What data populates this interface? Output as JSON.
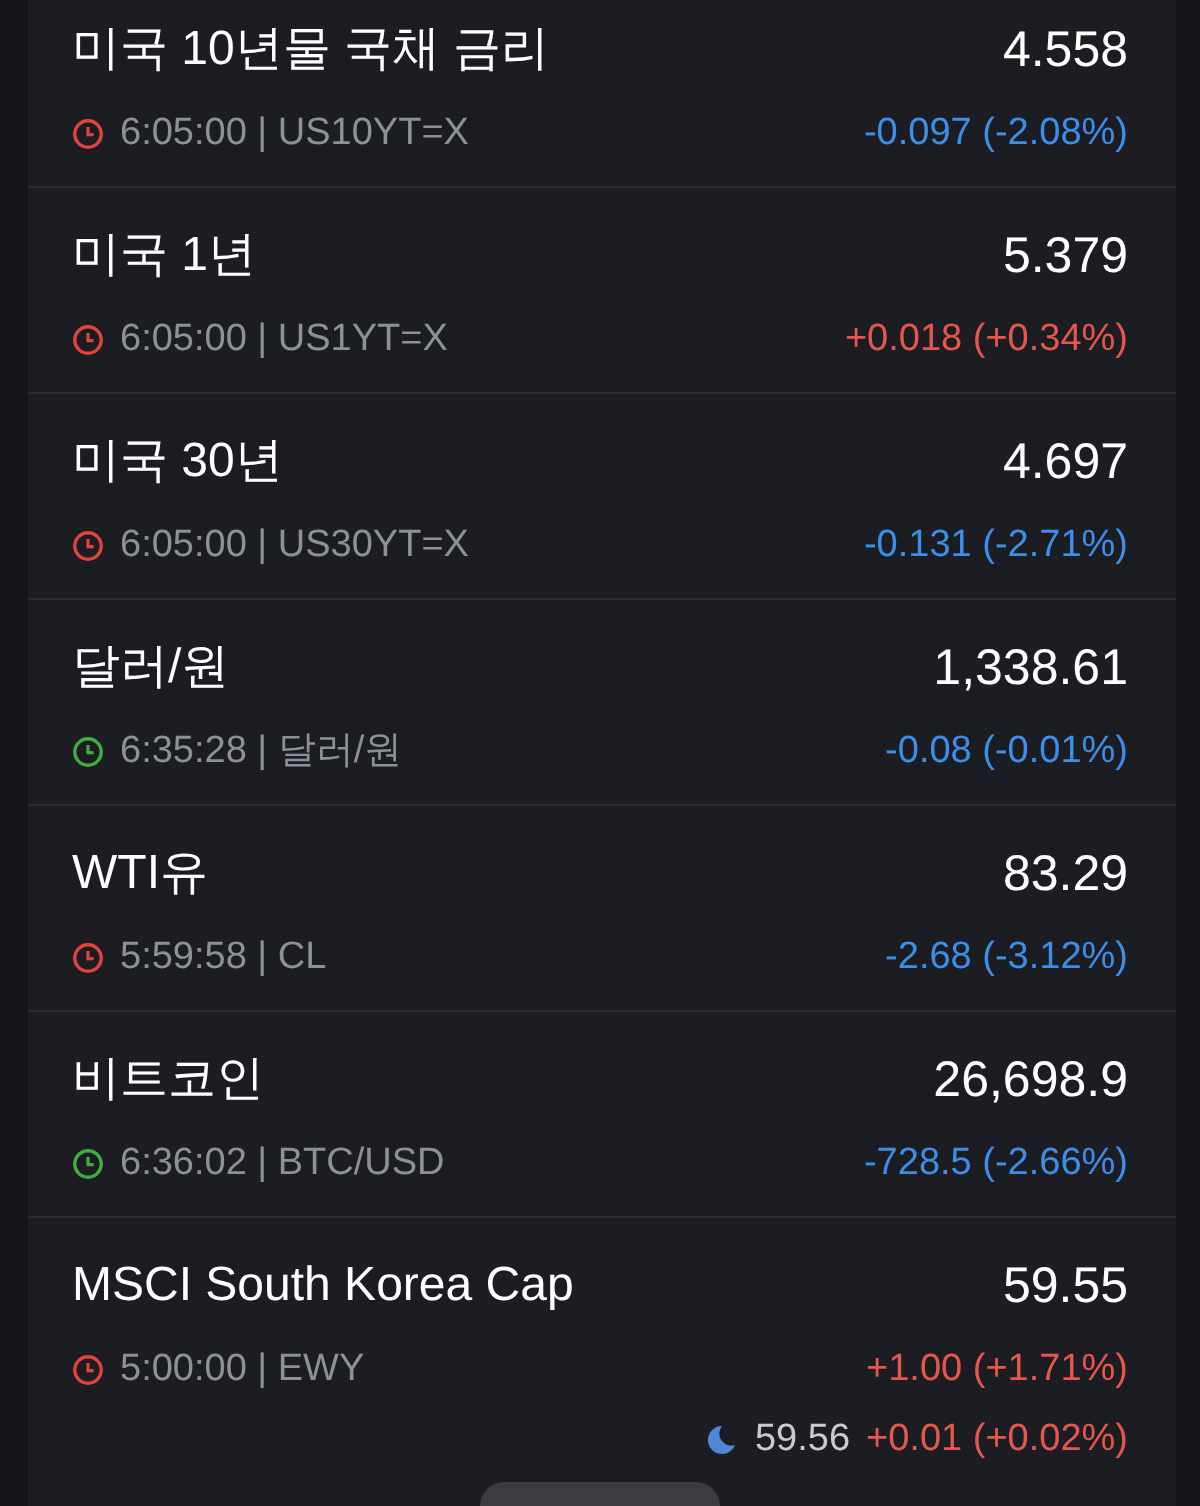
{
  "quotes": [
    {
      "name": "미국 10년물 국채 금리",
      "price": "4.558",
      "market_open": false,
      "time": "6:05:00 | US10YT=X",
      "change": "-0.097 (-2.08%)",
      "rising": false
    },
    {
      "name": "미국 1년",
      "price": "5.379",
      "market_open": false,
      "time": "6:05:00 | US1YT=X",
      "change": "+0.018 (+0.34%)",
      "rising": true
    },
    {
      "name": "미국 30년",
      "price": "4.697",
      "market_open": false,
      "time": "6:05:00 | US30YT=X",
      "change": "-0.131 (-2.71%)",
      "rising": false
    },
    {
      "name": "달러/원",
      "price": "1,338.61",
      "market_open": true,
      "time": "6:35:28 | 달러/원",
      "change": "-0.08 (-0.01%)",
      "rising": false
    },
    {
      "name": "WTI유",
      "price": "83.29",
      "market_open": false,
      "time": "5:59:58 | CL",
      "change": "-2.68 (-3.12%)",
      "rising": false
    },
    {
      "name": "비트코인",
      "price": "26,698.9",
      "market_open": true,
      "time": "6:36:02 | BTC/USD",
      "change": "-728.5 (-2.66%)",
      "rising": false
    },
    {
      "name": "MSCI South Korea Cap",
      "price": "59.55",
      "market_open": false,
      "time": "5:00:00 | EWY",
      "change": "+1.00 (+1.71%)",
      "rising": true,
      "after_hours": {
        "price": "59.56",
        "change": "+0.01 (+0.02%)",
        "rising": true
      }
    }
  ]
}
